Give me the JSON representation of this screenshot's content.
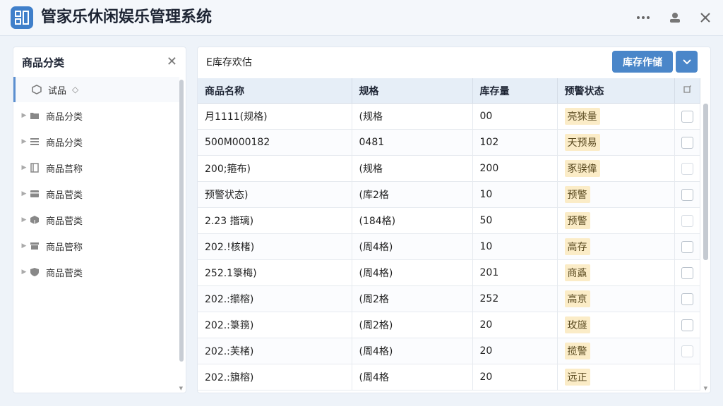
{
  "window": {
    "title": "管家乐休闲娱乐管理系统",
    "controls": [
      "more-icon",
      "user-icon",
      "close-icon"
    ]
  },
  "sidebar": {
    "title": "商品分类",
    "items": [
      {
        "label": "试品",
        "icon": "cube-icon",
        "selected": true
      },
      {
        "label": "商品分类",
        "icon": "folder-icon"
      },
      {
        "label": "商品分类",
        "icon": "list-icon"
      },
      {
        "label": "商品莒称",
        "icon": "book-icon"
      },
      {
        "label": "商品菅类",
        "icon": "box-icon"
      },
      {
        "label": "商品菅类",
        "icon": "package-icon"
      },
      {
        "label": "商品管称",
        "icon": "archive-icon"
      },
      {
        "label": "商品菅类",
        "icon": "shield-icon"
      }
    ]
  },
  "main": {
    "title": "E库存欢估",
    "primary_button": "库存作储",
    "columns": [
      "商品名称",
      "规格",
      "库存量",
      "预警状态"
    ],
    "rows": [
      {
        "name": "月1111(规格)",
        "spec": "(规格",
        "qty": "00",
        "status": "亮猍量"
      },
      {
        "name": "500M000182",
        "spec": "0481",
        "qty": "102",
        "status": "天预易"
      },
      {
        "name": "200;箍布)",
        "spec": "(规格",
        "qty": "200",
        "status": "豖骙偉"
      },
      {
        "name": "预警状态)",
        "spec": "(库2格",
        "qty": "10",
        "status": "预警"
      },
      {
        "name": "2.23 揩璃)",
        "spec": "(184格)",
        "qty": "50",
        "status": "预警"
      },
      {
        "name": "202.!核楮)",
        "spec": "(周4格)",
        "qty": "10",
        "status": "高存"
      },
      {
        "name": "252.1箓梅)",
        "spec": "(周4格)",
        "qty": "201",
        "status": "商鼒"
      },
      {
        "name": "202.:擶榕)",
        "spec": "(周2格",
        "qty": "252",
        "status": "高亰"
      },
      {
        "name": "202.:箓箉)",
        "spec": "(周2格)",
        "qty": "20",
        "status": "玫旞"
      },
      {
        "name": "202.:芙楮)",
        "spec": "(周4格)",
        "qty": "20",
        "status": "揽警"
      },
      {
        "name": "202.:簱榕)",
        "spec": "(周4格",
        "qty": "20",
        "status": "远正"
      }
    ]
  },
  "colors": {
    "accent": "#4a86c9",
    "badge_bg": "#fbecc7",
    "header_bg": "#e6eef7"
  }
}
